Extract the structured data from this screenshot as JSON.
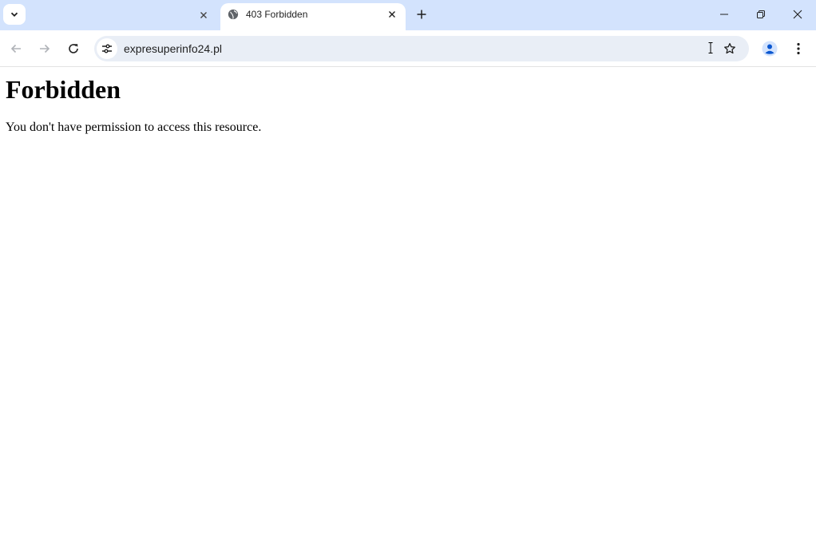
{
  "browser": {
    "tab_search_icon": "chevron-down-icon",
    "tabs": [
      {
        "title": "",
        "active": false
      },
      {
        "title": "403 Forbidden",
        "active": true,
        "favicon": "globe-icon"
      }
    ],
    "new_tab_icon": "plus-icon",
    "window_controls": [
      "minimize-icon",
      "restore-icon",
      "close-icon"
    ],
    "address_bar": {
      "url": "expresuperinfo24.pl",
      "site_info_icon": "tune-icon",
      "bookmark_icon": "star-icon"
    },
    "colors": {
      "tabstrip_bg": "#d3e3fd",
      "omnibox_bg": "#e9eef6",
      "profile_accent": "#0b57d0"
    }
  },
  "page": {
    "heading": "Forbidden",
    "message": "You don't have permission to access this resource."
  }
}
